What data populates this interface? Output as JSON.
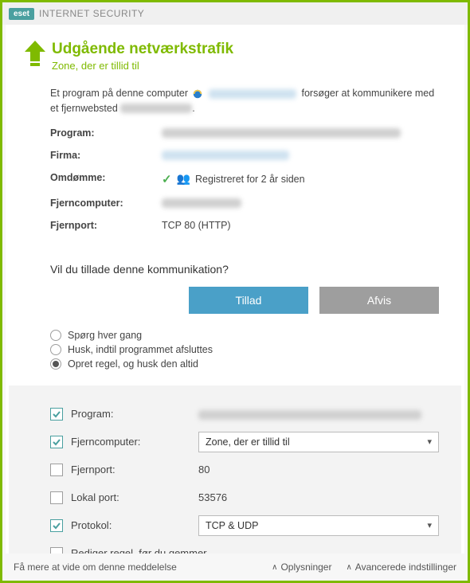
{
  "titlebar": {
    "brand": "eset",
    "product": "INTERNET SECURITY"
  },
  "header": {
    "title": "Udgående netværkstrafik",
    "subtitle": "Zone, der er tillid til"
  },
  "intro": {
    "pre": "Et program på denne computer",
    "mid": "forsøger at kommunikere med et fjernwebsted"
  },
  "fields": {
    "program": "Program:",
    "firma": "Firma:",
    "omdomme": "Omdømme:",
    "omdomme_val": "Registreret for 2 år siden",
    "fjerncomputer": "Fjerncomputer:",
    "fjernport": "Fjernport:",
    "fjernport_val": "TCP 80 (HTTP)"
  },
  "question": "Vil du tillade denne kommunikation?",
  "buttons": {
    "allow": "Tillad",
    "deny": "Afvis"
  },
  "radios": {
    "r1": "Spørg hver gang",
    "r2": "Husk, indtil programmet afsluttes",
    "r3": "Opret regel, og husk den altid"
  },
  "rule": {
    "program": "Program:",
    "fjerncomputer": "Fjerncomputer:",
    "fjerncomputer_val": "Zone, der er tillid til",
    "fjernport": "Fjernport:",
    "fjernport_val": "80",
    "lokalport": "Lokal port:",
    "lokalport_val": "53576",
    "protokol": "Protokol:",
    "protokol_val": "TCP & UDP",
    "edit": "Rediger regel, før du gemmer"
  },
  "footer": {
    "learn": "Få mere at vide om denne meddelelse",
    "info": "Oplysninger",
    "adv": "Avancerede indstillinger"
  }
}
